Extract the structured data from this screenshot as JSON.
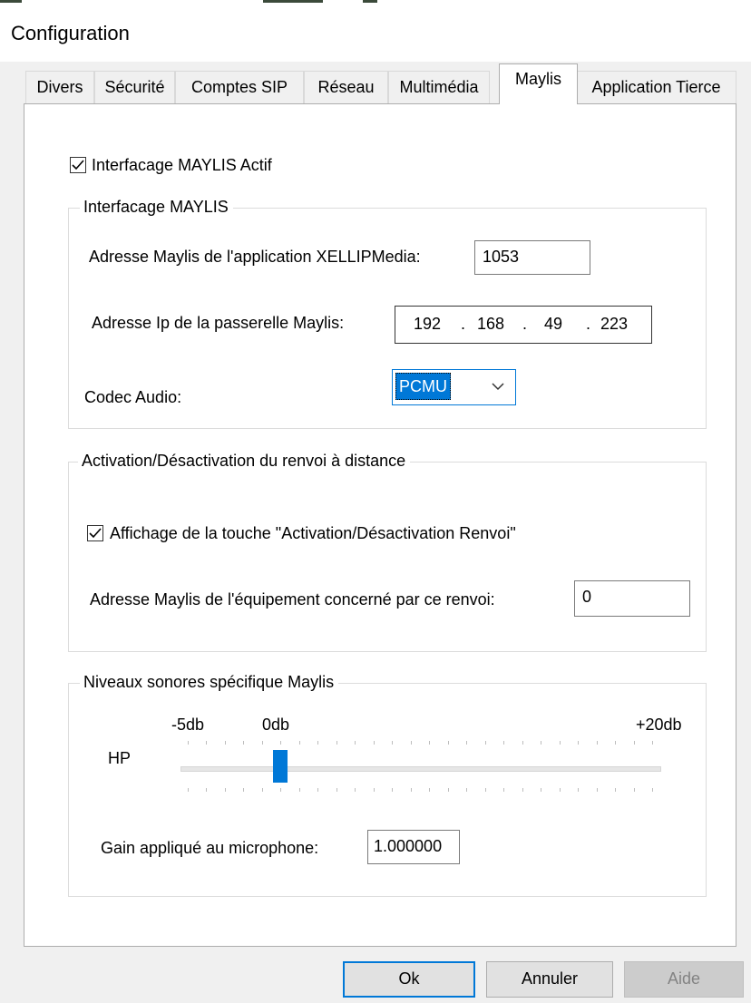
{
  "window": {
    "title": "Configuration"
  },
  "tabs": [
    {
      "label": "Divers",
      "active": false
    },
    {
      "label": "Sécurité",
      "active": false
    },
    {
      "label": "Comptes SIP",
      "active": false
    },
    {
      "label": "Réseau",
      "active": false
    },
    {
      "label": "Multimédia",
      "active": false
    },
    {
      "label": "Maylis",
      "active": true
    },
    {
      "label": "Application Tierce",
      "active": false
    }
  ],
  "maylis": {
    "active_checkbox": {
      "label": "Interfacage MAYLIS Actif",
      "checked": true
    },
    "interfacage_group": {
      "legend": "Interfacage MAYLIS",
      "address_label": "Adresse Maylis de l'application XELLIPMedia:",
      "address_value": "1053",
      "ip_label": "Adresse Ip de la passerelle Maylis:",
      "ip": {
        "o1": "192",
        "o2": "168",
        "o3": "49",
        "o4": "223",
        "dot": "."
      },
      "codec_label": "Codec Audio:",
      "codec_value": "PCMU"
    },
    "renvoi_group": {
      "legend": "Activation/Désactivation du renvoi à distance",
      "checkbox_label": "Affichage de la touche \"Activation/Désactivation Renvoi\"",
      "checkbox_checked": true,
      "equip_label": "Adresse Maylis de l'équipement concerné par ce renvoi:",
      "equip_value": "0"
    },
    "sound_group": {
      "legend": "Niveaux sonores spécifique Maylis",
      "scale_min": "-5db",
      "scale_zero": "0db",
      "scale_max": "+20db",
      "hp_label": "HP",
      "hp_level_db": 0,
      "gain_label": "Gain appliqué au microphone:",
      "gain_value": "1.000000"
    }
  },
  "buttons": {
    "ok": "Ok",
    "cancel": "Annuler",
    "help": "Aide"
  },
  "colors": {
    "accent": "#0078d7",
    "panel": "#ffffff",
    "dialog": "#f0f0f0"
  }
}
